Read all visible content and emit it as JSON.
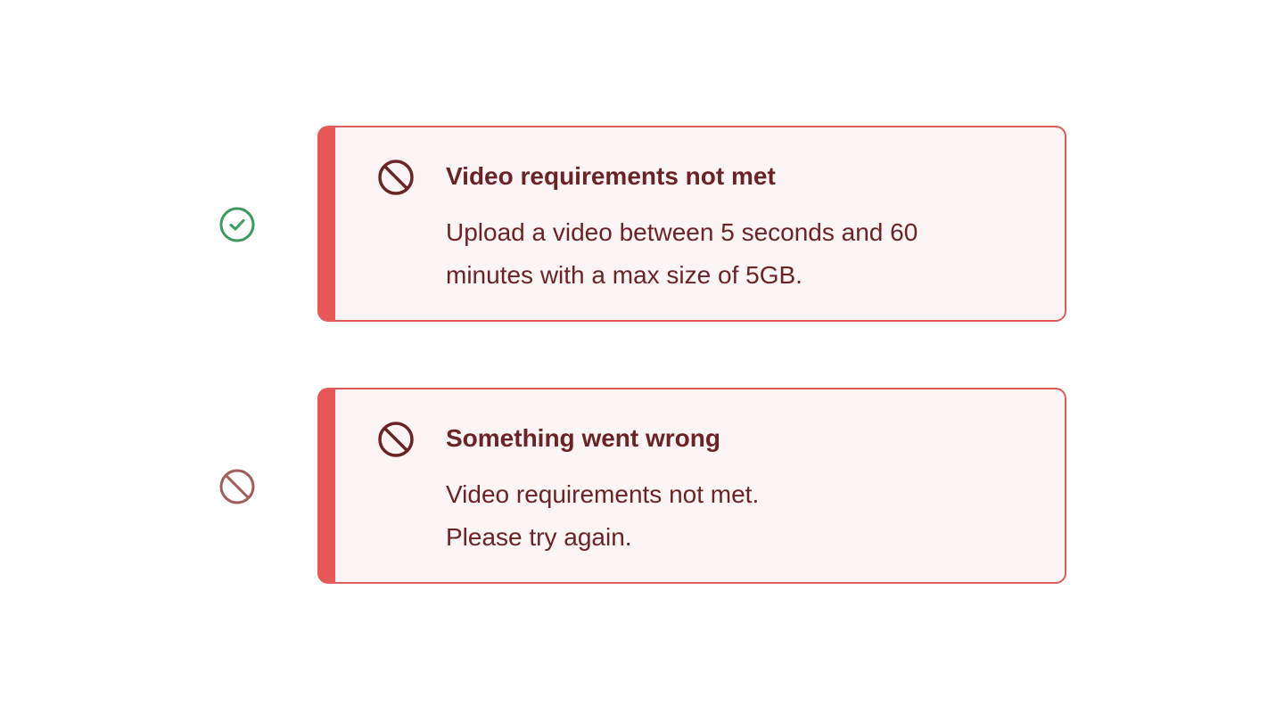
{
  "colors": {
    "success_green": "#3c9a63",
    "error_red_muted": "#a35c5c",
    "alert_accent": "#e85757",
    "alert_border": "#e05a5a",
    "alert_background": "#fdf4f5",
    "alert_text": "#6b2426"
  },
  "rows": [
    {
      "status_icon": "check-circle-icon",
      "alert": {
        "icon": "block-icon",
        "title": "Video requirements not met",
        "body_lines": [
          "Upload a video between 5 seconds and 60",
          "minutes with a max size of 5GB."
        ]
      }
    },
    {
      "status_icon": "block-icon",
      "alert": {
        "icon": "block-icon",
        "title": "Something went wrong",
        "body_lines": [
          "Video requirements not met.",
          "Please try again."
        ]
      }
    }
  ]
}
